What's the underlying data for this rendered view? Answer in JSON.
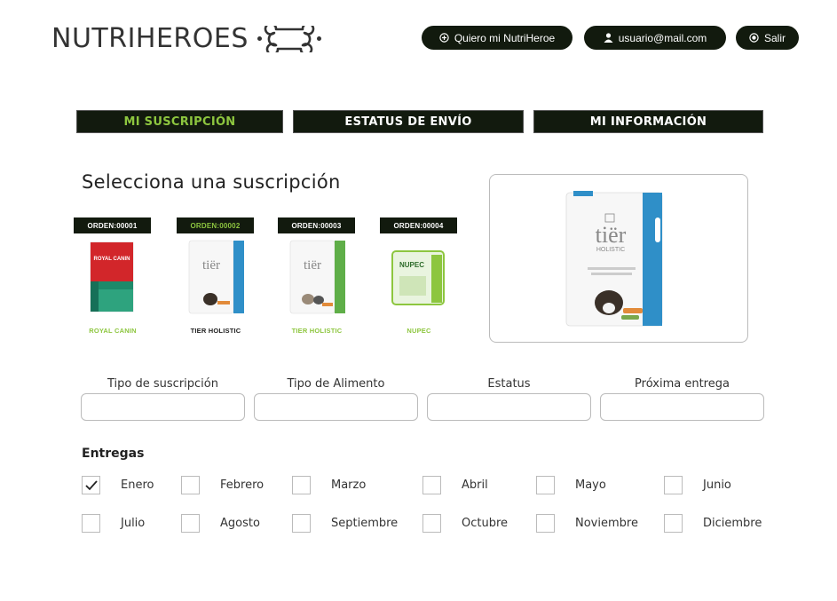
{
  "header": {
    "logo_text": "NUTRIHEROES",
    "buttons": {
      "nutri": "Quiero mi NutriHeroe",
      "user": "usuario@mail.com",
      "logout": "Salir"
    }
  },
  "tabs": [
    {
      "label": "MI SUSCRIPCIÓN",
      "active": true
    },
    {
      "label": "ESTATUS DE ENVÍO",
      "active": false
    },
    {
      "label": "MI INFORMACIÓN",
      "active": false
    }
  ],
  "section_title": "Selecciona una suscripción",
  "products": [
    {
      "order": "ORDEN:00001",
      "name": "ROYAL CANIN",
      "order_color": "white",
      "name_color": "green"
    },
    {
      "order": "ORDEN:00002",
      "name": "TIER HOLISTIC",
      "order_color": "green",
      "name_color": "dark"
    },
    {
      "order": "ORDEN:00003",
      "name": "TIER HOLISTIC",
      "order_color": "white",
      "name_color": "green"
    },
    {
      "order": "ORDEN:00004",
      "name": "NUPEC",
      "order_color": "white",
      "name_color": "green"
    }
  ],
  "fields": [
    {
      "label": "Tipo de suscripción",
      "value": ""
    },
    {
      "label": "Tipo de Alimento",
      "value": ""
    },
    {
      "label": "Estatus",
      "value": ""
    },
    {
      "label": "Próxima entrega",
      "value": ""
    }
  ],
  "entregas": {
    "title": "Entregas",
    "months": [
      {
        "label": "Enero",
        "checked": true
      },
      {
        "label": "Febrero",
        "checked": false
      },
      {
        "label": "Marzo",
        "checked": false
      },
      {
        "label": "Abril",
        "checked": false
      },
      {
        "label": "Mayo",
        "checked": false
      },
      {
        "label": "Junio",
        "checked": false
      },
      {
        "label": "Julio",
        "checked": false
      },
      {
        "label": "Agosto",
        "checked": false
      },
      {
        "label": "Septiembre",
        "checked": false
      },
      {
        "label": "Octubre",
        "checked": false
      },
      {
        "label": "Noviembre",
        "checked": false
      },
      {
        "label": "Diciembre",
        "checked": false
      }
    ]
  },
  "colors": {
    "dark": "#121a0e",
    "accent_green": "#8dc63f",
    "tier_blue": "#2f8fc8",
    "royal_red": "#d2262a"
  }
}
